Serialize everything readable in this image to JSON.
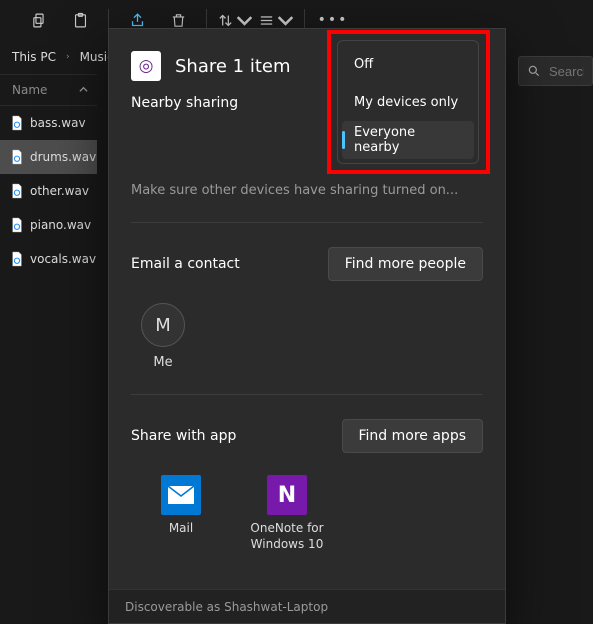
{
  "toolbar": {
    "tooltips": {
      "copy": "Copy",
      "paste": "Paste",
      "share": "Share",
      "delete": "Delete",
      "sort": "Sort",
      "view": "View",
      "more": "See more"
    }
  },
  "breadcrumb": {
    "items": [
      "This PC",
      "Music"
    ]
  },
  "search": {
    "placeholder": "Search"
  },
  "columns": {
    "name": "Name"
  },
  "files": [
    {
      "name": "bass.wav"
    },
    {
      "name": "drums.wav",
      "selected": true
    },
    {
      "name": "other.wav"
    },
    {
      "name": "piano.wav"
    },
    {
      "name": "vocals.wav"
    }
  ],
  "share": {
    "title": "Share 1 item",
    "nearby": {
      "title": "Nearby sharing",
      "options": [
        "Off",
        "My devices only",
        "Everyone nearby"
      ],
      "selected_index": 2,
      "hint": "Make sure other devices have sharing turned on..."
    },
    "email": {
      "title": "Email a contact",
      "find_more": "Find more people",
      "contacts": [
        {
          "initial": "M",
          "label": "Me"
        }
      ]
    },
    "apps": {
      "title": "Share with app",
      "find_more": "Find more apps",
      "items": [
        {
          "name": "Mail",
          "color": "#0078d4",
          "glyph": "mail"
        },
        {
          "name": "OneNote for Windows 10",
          "color": "#7719aa",
          "glyph": "N"
        }
      ]
    },
    "footer": "Discoverable as Shashwat-Laptop"
  }
}
